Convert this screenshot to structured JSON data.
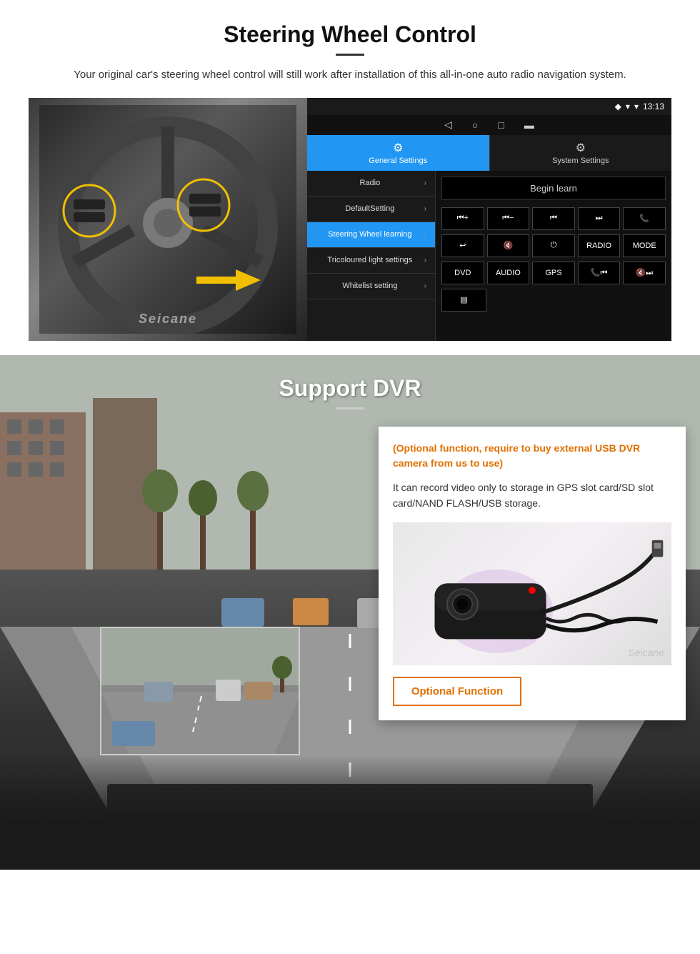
{
  "page": {
    "steering_section": {
      "title": "Steering Wheel Control",
      "subtitle": "Your original car's steering wheel control will still work after installation of this all-in-one auto radio navigation system.",
      "watermark": "Seicane"
    },
    "android_screen": {
      "status_bar": {
        "signal_icon": "▼",
        "wifi_icon": "▾",
        "time": "13:13",
        "location_icon": "◆"
      },
      "nav_bar": {
        "back": "◁",
        "home": "○",
        "recent": "□",
        "menu": "▬"
      },
      "tabs": [
        {
          "label": "General Settings",
          "icon": "⚙",
          "active": true
        },
        {
          "label": "System Settings",
          "icon": "🔧",
          "active": false
        }
      ],
      "menu_items": [
        {
          "label": "Radio",
          "arrow": ">",
          "active": false
        },
        {
          "label": "DefaultSetting",
          "arrow": ">",
          "active": false
        },
        {
          "label": "Steering Wheel learning",
          "arrow": ">",
          "active": true
        },
        {
          "label": "Tricoloured light settings",
          "arrow": ">",
          "active": false
        },
        {
          "label": "Whitelist setting",
          "arrow": ">",
          "active": false
        }
      ],
      "begin_learn": "Begin learn",
      "control_buttons_row1": [
        "⏮+",
        "⏮-",
        "⏮",
        "⏭",
        "📞"
      ],
      "control_buttons_row2": [
        "↩",
        "🔇",
        "⏻",
        "RADIO",
        "MODE"
      ],
      "control_buttons_row3": [
        "DVD",
        "AUDIO",
        "GPS",
        "📞⏮",
        "🔇⏭"
      ],
      "control_buttons_row4_icon": "▤"
    },
    "dvr_section": {
      "title": "Support DVR",
      "optional_note": "(Optional function, require to buy external USB DVR camera from us to use)",
      "description": "It can record video only to storage in GPS slot card/SD slot card/NAND FLASH/USB storage.",
      "optional_function_label": "Optional Function"
    }
  }
}
